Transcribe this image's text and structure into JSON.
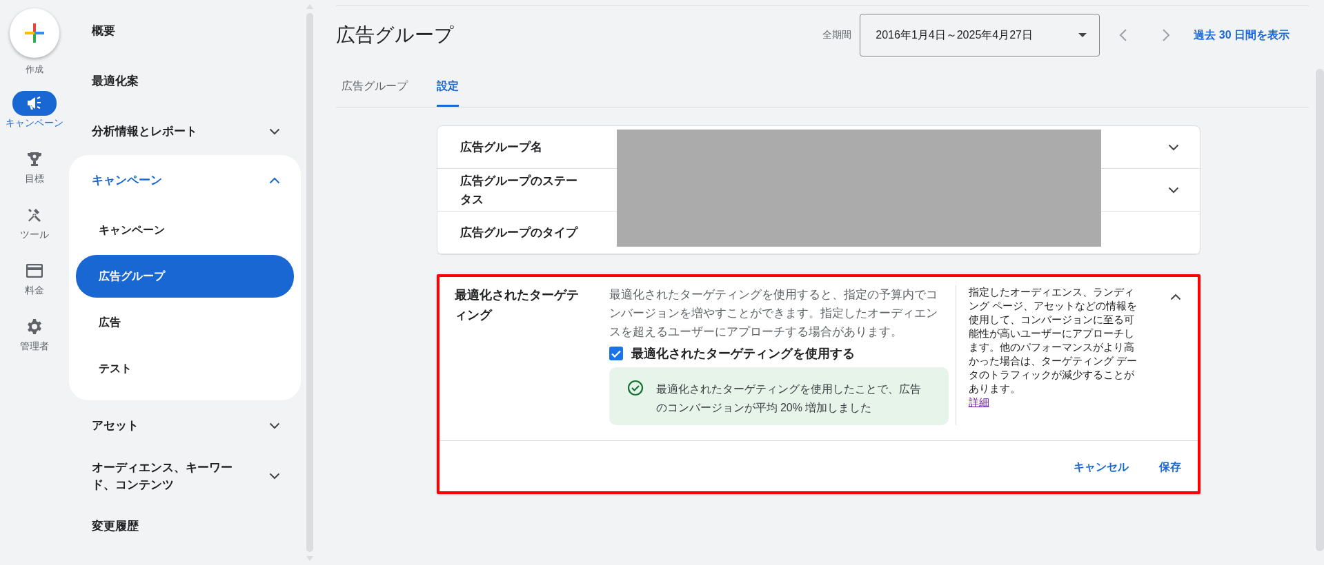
{
  "rail": {
    "create_label": "作成",
    "items": [
      {
        "label": "キャンペーン",
        "kind": "megaphone",
        "selected": true
      },
      {
        "label": "目標",
        "kind": "trophy",
        "selected": false
      },
      {
        "label": "ツール",
        "kind": "tools",
        "selected": false
      },
      {
        "label": "料金",
        "kind": "card",
        "selected": false
      },
      {
        "label": "管理者",
        "kind": "gear",
        "selected": false
      }
    ]
  },
  "nav": {
    "items": [
      {
        "label": "概要",
        "kind": "link"
      },
      {
        "label": "最適化案",
        "kind": "link"
      },
      {
        "label": "分析情報とレポート",
        "kind": "group",
        "expanded": false
      },
      {
        "label": "キャンペーン",
        "kind": "group",
        "expanded": true,
        "children": [
          {
            "label": "キャンペーン",
            "selected": false
          },
          {
            "label": "広告グループ",
            "selected": true
          },
          {
            "label": "広告",
            "selected": false
          },
          {
            "label": "テスト",
            "selected": false
          }
        ]
      },
      {
        "label": "アセット",
        "kind": "group",
        "expanded": false
      },
      {
        "label": "オーディエンス、キーワード、コンテンツ",
        "kind": "group",
        "expanded": false
      },
      {
        "label": "変更履歴",
        "kind": "link"
      }
    ]
  },
  "header": {
    "title": "広告グループ",
    "period_label": "全期間",
    "date_range": "2016年1月4日～2025年4月27日",
    "show_last_30": "過去 30 日間を表示"
  },
  "tabs": [
    {
      "label": "広告グループ",
      "selected": false
    },
    {
      "label": "設定",
      "selected": true
    }
  ],
  "settings_rows": [
    {
      "label": "広告グループ名",
      "kind": "collapsible",
      "expanded": false
    },
    {
      "label": "広告グループのステータス",
      "kind": "collapsible",
      "expanded": false
    },
    {
      "label": "広告グループのタイプ",
      "kind": "static"
    }
  ],
  "optimized_targeting": {
    "label": "最適化されたターゲティング",
    "expanded": true,
    "description": "最適化されたターゲティングを使用すると、指定の予算内でコンバージョンを増やすことができます。指定したオーディエンスを超えるユーザーにアプローチする場合があります。",
    "checkbox": {
      "label": "最適化されたターゲティングを使用する",
      "checked": true
    },
    "notice": "最適化されたターゲティングを使用したことで、広告のコンバージョンが平均 20% 増加しました",
    "help_text": "指定したオーディエンス、ランディング ページ、アセットなどの情報を使用して、コンバージョンに至る可能性が高いユーザーにアプローチします。他のパフォーマンスがより高かった場合は、ターゲティング データのトラフィックが減少することがあります。",
    "help_link": "詳細",
    "buttons": [
      {
        "label": "キャンセル"
      },
      {
        "label": "保存"
      }
    ]
  }
}
